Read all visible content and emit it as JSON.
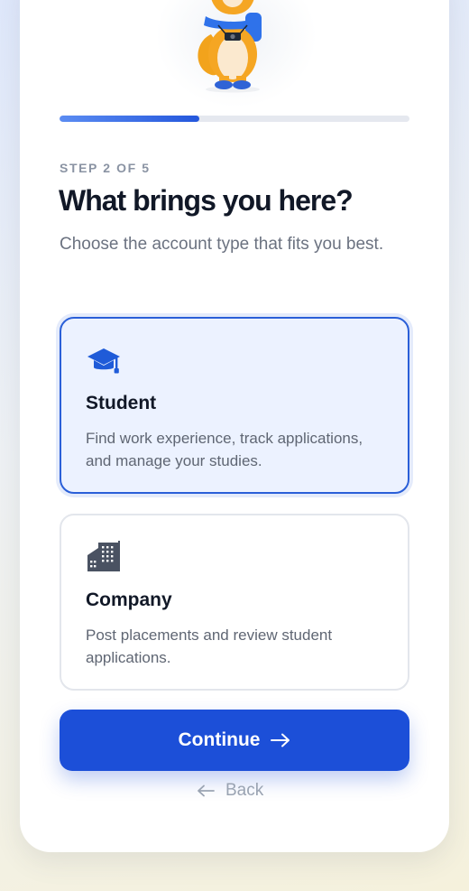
{
  "progress": {
    "current_step": 2,
    "total_steps": 5,
    "fraction": 0.4
  },
  "header": {
    "step_label": "STEP 2 OF 5",
    "title": "What brings you here?",
    "subtitle": "Choose the account type that fits you best."
  },
  "options": [
    {
      "icon": "graduation-cap-icon",
      "title": "Student",
      "description": "Find work experience, track applications, and manage your studies.",
      "selected": true
    },
    {
      "icon": "office-building-icon",
      "title": "Company",
      "description": "Post placements and review student applications.",
      "selected": false
    }
  ],
  "actions": {
    "continue_label": "Continue",
    "continue_icon": "arrow-right-icon",
    "back_label": "Back",
    "back_icon": "arrow-left-icon"
  },
  "colors": {
    "accent": "#1c4fd8",
    "selected_border": "#2a5fd8",
    "selected_bg": "#ecf2ff",
    "text_primary": "#111827",
    "text_muted": "#6b7280"
  }
}
